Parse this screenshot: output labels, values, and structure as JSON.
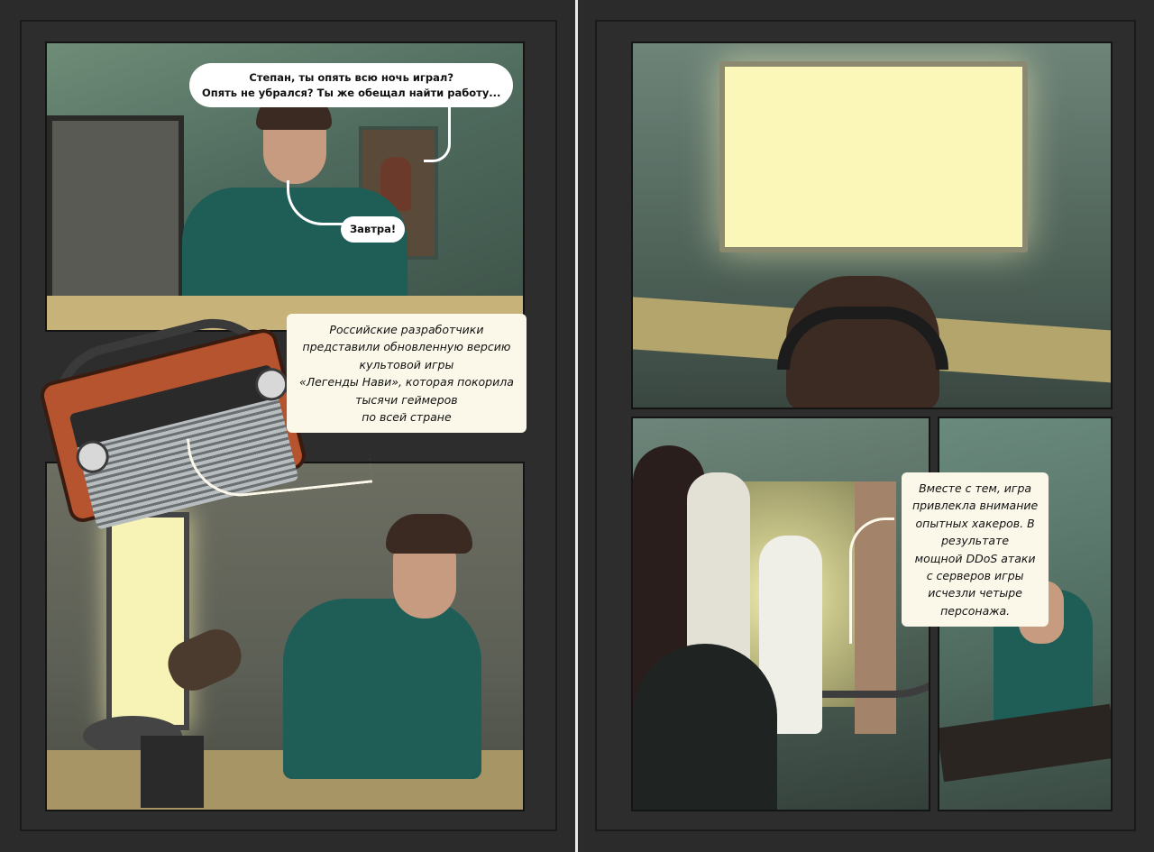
{
  "page1": {
    "panel1": {
      "speech_mother": {
        "lines": [
          "Степан, ты опять всю ночь играл?",
          "Опять не убрался? Ты же обещал найти работу..."
        ]
      },
      "speech_stepan": "Завтра!"
    },
    "radio_caption": {
      "lines": [
        "Российские разработчики",
        "представили обновленную версию",
        "культовой игры",
        "«Легенды Нави», которая покорила",
        "тысячи геймеров",
        "по всей стране"
      ]
    }
  },
  "page2": {
    "caption_hackers": {
      "lines": [
        "Вместе с тем, игра",
        "привлекла внимание",
        "опытных хакеров. В",
        "результате",
        "мощной DDoS атаки",
        "с серверов игры",
        "исчезли четыре",
        "персонажа."
      ]
    }
  },
  "colors": {
    "background": "#2b2b2b",
    "sweater": "#1f5d57",
    "screen_glow": "#fbf7b9",
    "radio": "#b6542f"
  }
}
